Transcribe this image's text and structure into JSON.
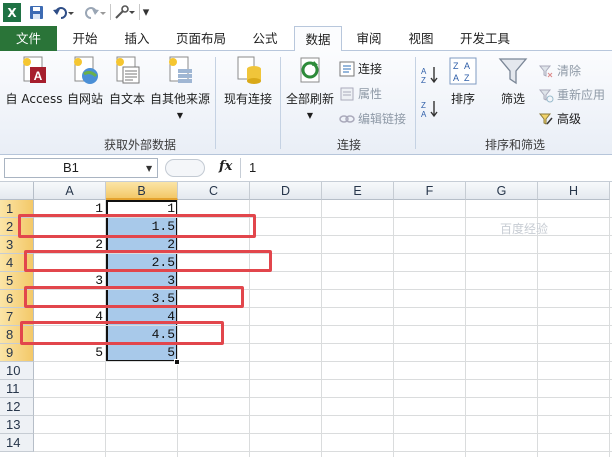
{
  "colors": {
    "file_tab": "#2a7438",
    "selection": "#a8c9ea",
    "highlight_box": "#e2464c",
    "header_selected": "#f3c868"
  },
  "quick_access": {
    "icons": [
      "excel-logo-icon",
      "save-icon",
      "undo-icon",
      "redo-icon",
      "customize-tool-icon",
      "more-arrow-icon"
    ],
    "logo": "X",
    "more": "▾"
  },
  "tabs": [
    {
      "label": "文件"
    },
    {
      "label": "开始"
    },
    {
      "label": "插入"
    },
    {
      "label": "页面布局"
    },
    {
      "label": "公式"
    },
    {
      "label": "数据"
    },
    {
      "label": "审阅"
    },
    {
      "label": "视图"
    },
    {
      "label": "开发工具"
    }
  ],
  "ribbon": {
    "external": {
      "group_label": "获取外部数据",
      "access": "自 Access",
      "web": "自网站",
      "text": "自文本",
      "other": "自其他来源",
      "existing": "现有连接"
    },
    "connections": {
      "group_label": "连接",
      "refresh_all": "全部刷新",
      "connections": "连接",
      "properties": "属性",
      "edit_links": "编辑链接"
    },
    "sort_filter": {
      "group_label": "排序和筛选",
      "sort_az": "A↓Z",
      "sort_za": "Z↓A",
      "sort": "排序",
      "filter": "筛选",
      "clear": "清除",
      "reapply": "重新应用",
      "advanced": "高级"
    }
  },
  "formula_bar": {
    "name_box": "B1",
    "fx": "fx",
    "value": "1"
  },
  "sheet": {
    "columns": [
      "A",
      "B",
      "C",
      "D",
      "E",
      "F",
      "G",
      "H"
    ],
    "rows": [
      "1",
      "2",
      "3",
      "4",
      "5",
      "6",
      "7",
      "8",
      "9",
      "10",
      "11",
      "12",
      "13",
      "14"
    ],
    "column_a": [
      {
        "row": 1,
        "value": "1"
      },
      {
        "row": 3,
        "value": "2"
      },
      {
        "row": 5,
        "value": "3"
      },
      {
        "row": 7,
        "value": "4"
      },
      {
        "row": 9,
        "value": "5"
      }
    ],
    "column_b": [
      "1",
      "1.5",
      "2",
      "2.5",
      "3",
      "3.5",
      "4",
      "4.5",
      "5"
    ]
  },
  "watermark": "百度经验"
}
